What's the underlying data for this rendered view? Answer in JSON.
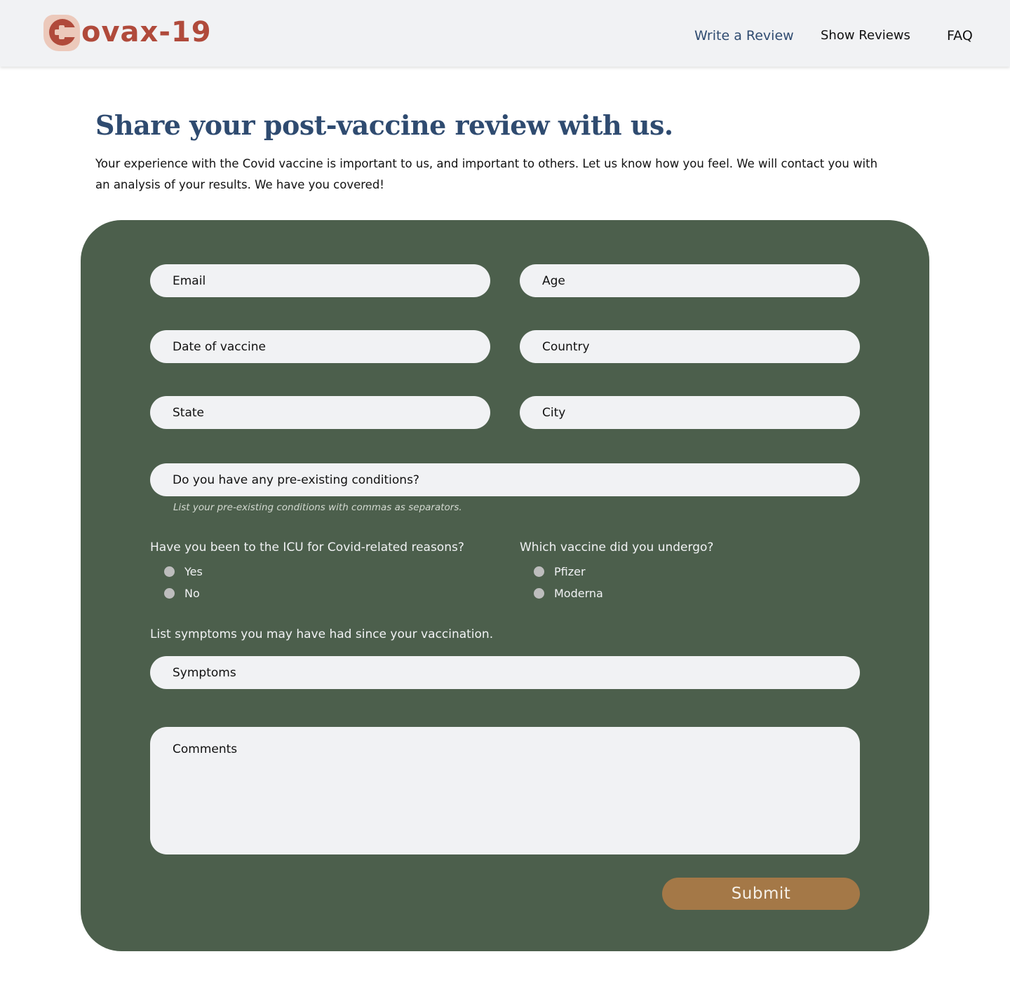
{
  "header": {
    "logo_text": "ovax-19",
    "logo_icon": "medical-cross-icon",
    "nav": {
      "write_review": "Write a Review",
      "show_reviews": "Show Reviews",
      "faq": "FAQ"
    }
  },
  "intro": {
    "title": "Share your post-vaccine review with us.",
    "body": "Your experience with the Covid vaccine is important to us, and important to others. Let us know how you feel. We will contact you with an analysis of your results. We have you covered!"
  },
  "form": {
    "email_placeholder": "Email",
    "age_placeholder": "Age",
    "date_placeholder": "Date of vaccine",
    "country_placeholder": "Country",
    "state_placeholder": "State",
    "city_placeholder": "City",
    "conditions_placeholder": "Do you have any pre-existing conditions?",
    "conditions_hint": "List your pre-existing conditions with commas as separators.",
    "icu_question": "Have you been to the ICU for Covid-related reasons?",
    "icu_options": [
      "Yes",
      "No"
    ],
    "vaccine_question": "Which vaccine did you undergo?",
    "vaccine_options": [
      "Pfizer",
      "Moderna"
    ],
    "symptoms_label": "List symptoms you may have had since your vaccination.",
    "symptoms_placeholder": "Symptoms",
    "comments_placeholder": "Comments",
    "submit_label": "Submit"
  },
  "colors": {
    "brand": "#b04a3b",
    "title": "#2f4b70",
    "card": "#4c5f4c",
    "submit": "#a47847",
    "field": "#f1f2f4"
  }
}
